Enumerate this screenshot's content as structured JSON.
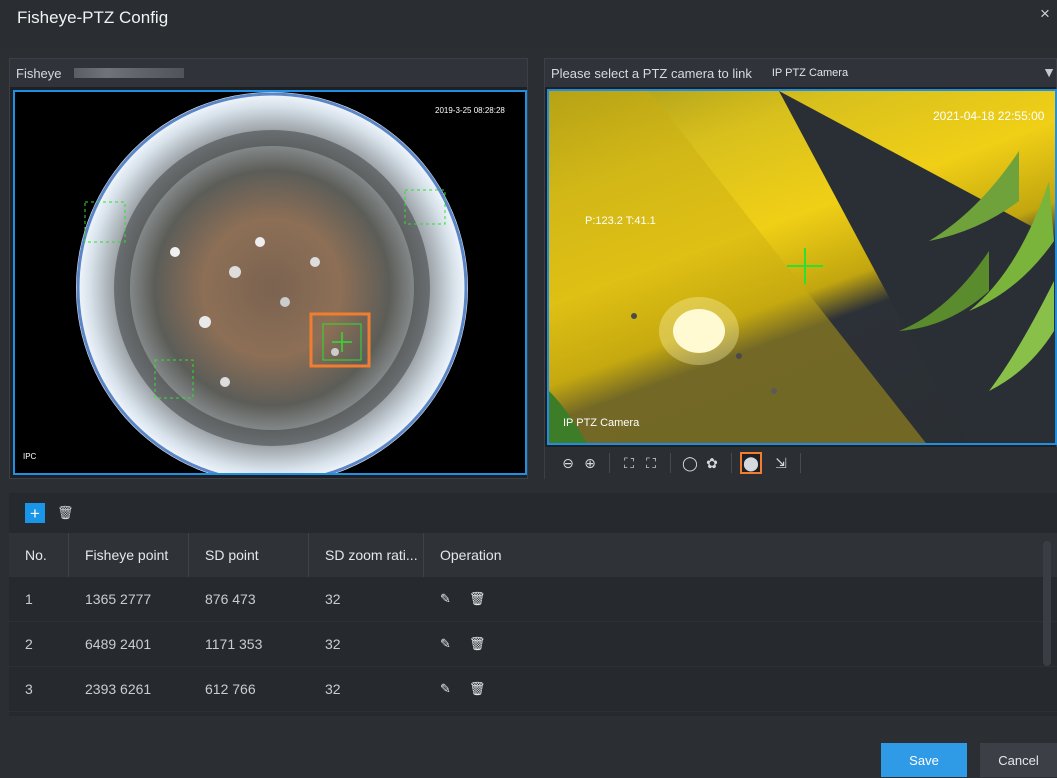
{
  "dialog": {
    "title": "Fisheye-PTZ Config",
    "close_glyph": "×"
  },
  "fisheye_panel": {
    "label": "Fisheye",
    "timestamp": "2019-3-25 08:28:28",
    "watermark": "IPC"
  },
  "ptz_panel": {
    "prompt": "Please select a PTZ camera to link",
    "camera_selected": "IP PTZ Camera",
    "dropdown_glyph": "▼",
    "timestamp": "2021-04-18 22:55:00",
    "position_text": "P:123.2 T:41.1",
    "overlay_name": "IP PTZ Camera"
  },
  "ptz_toolbar": {
    "icons": [
      "zoom-out-icon",
      "zoom-in-icon",
      "focus-near-icon",
      "focus-far-icon",
      "iris-icon",
      "aperture-icon",
      "mouse-icon",
      "pointer-select-icon"
    ],
    "glyphs": [
      "⊖",
      "⊕",
      "⛶",
      "⛶",
      "◯",
      "✿",
      "⬤",
      "⇲"
    ]
  },
  "table": {
    "add_glyph": "+",
    "delete_glyph": "🗑",
    "columns": [
      "No.",
      "Fisheye point",
      "SD point",
      "SD zoom rati...",
      "Operation"
    ],
    "rows": [
      {
        "no": "1",
        "fisheye_point": "1365 2777",
        "sd_point": "876 473",
        "zoom": "32"
      },
      {
        "no": "2",
        "fisheye_point": "6489 2401",
        "sd_point": "1171 353",
        "zoom": "32"
      },
      {
        "no": "3",
        "fisheye_point": "2393 6261",
        "sd_point": "612 766",
        "zoom": "32"
      }
    ],
    "edit_glyph": "✎",
    "trash_glyph": "🗑"
  },
  "footer": {
    "save_label": "Save",
    "cancel_label": "Cancel"
  },
  "colors": {
    "accent": "#1a96e8",
    "active_outline": "#f07d30",
    "crosshair": "#2ee02e",
    "background": "#2b2e33"
  }
}
